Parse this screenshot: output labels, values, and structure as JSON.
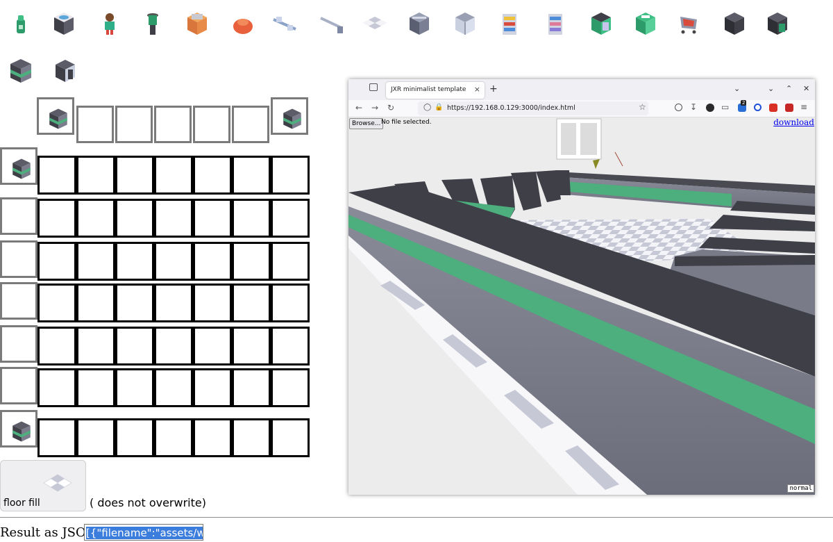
{
  "palette": {
    "assets": [
      {
        "name": "green-robot-icon"
      },
      {
        "name": "sink-icon"
      },
      {
        "name": "character-icon"
      },
      {
        "name": "stool-icon"
      },
      {
        "name": "armchair-icon"
      },
      {
        "name": "bean-bag-icon"
      },
      {
        "name": "cable-connector-icon"
      },
      {
        "name": "pipe-icon"
      },
      {
        "name": "floor-tile-icon"
      },
      {
        "name": "steel-block-icon"
      },
      {
        "name": "double-door-icon"
      },
      {
        "name": "shelf-yellow-icon"
      },
      {
        "name": "shelf-blue-icon"
      },
      {
        "name": "vending-machine-icon"
      },
      {
        "name": "cash-register-icon"
      },
      {
        "name": "shopping-cart-icon"
      },
      {
        "name": "dark-cabinet-icon"
      },
      {
        "name": "green-locker-icon"
      },
      {
        "name": "wall-block-icon"
      },
      {
        "name": "doorway-icon"
      }
    ]
  },
  "floor_fill": {
    "label": "floor fill",
    "note": "( does not overwrite)"
  },
  "result": {
    "label": "Result as JSON :",
    "value": "[{\"filename\":\"assets/wall.g"
  },
  "browser": {
    "tab_title": "JXR minimalist template",
    "url": "https://192.168.0.129:3000/index.html",
    "extension_badge": "2",
    "browse_button": "Browse...",
    "file_status": "No file selected.",
    "download_link": "download",
    "mode_badge": "normal",
    "tab_close": "×",
    "new_tab": "+"
  },
  "colors": {
    "wall_dark": "#3f3f48",
    "wall_stripe": "#4caf7d",
    "wall_side": "#7c7d8c",
    "floor_check": "#c6c8d6"
  }
}
